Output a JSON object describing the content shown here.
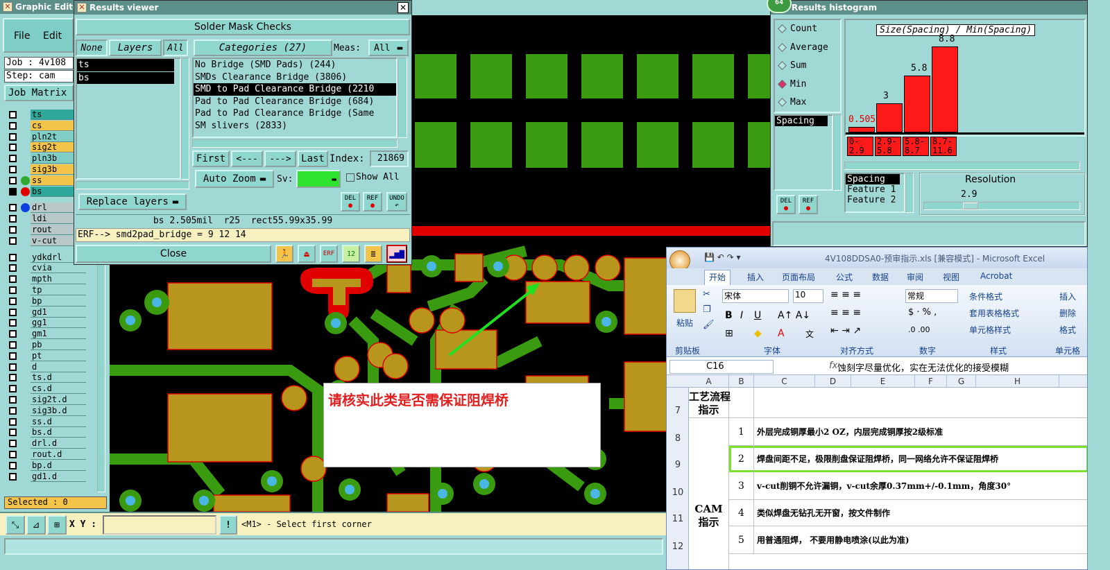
{
  "graphic_editor": {
    "title": "Graphic Editor",
    "menu": [
      "File",
      "Edit"
    ],
    "job": "Job : 4v108",
    "step": "Step: cam",
    "job_matrix": "Job Matrix",
    "layers": [
      "ts",
      "cs",
      "pln2t",
      "sig2t",
      "pln3b",
      "sig3b",
      "ss",
      "bs",
      "drl",
      "ldi",
      "rout",
      "v-cut",
      "ydkdrl",
      "cvia",
      "mpth",
      "tp",
      "bp",
      "gd1",
      "gg1",
      "gm1",
      "pb",
      "pt",
      "d",
      "ts.d",
      "cs.d",
      "sig2t.d",
      "sig3b.d",
      "ss.d",
      "bs.d",
      "drl.d",
      "rout.d",
      "bp.d",
      "gd1.d"
    ],
    "selected": "Selected : 0",
    "xy_label": "X Y :",
    "status_hint": "<M1> - Select first corner"
  },
  "results_viewer": {
    "title": "Results viewer",
    "header": "Solder Mask Checks",
    "none": "None",
    "layers": "Layers",
    "all": "All",
    "categories": "Categories (27)",
    "meas_label": "Meas:",
    "meas_value": "All",
    "layer_list": [
      "ts",
      "bs"
    ],
    "category_list": [
      "No Bridge (SMD Pads) (244)",
      "SMDs Clearance Bridge (3806)",
      "SMD to Pad Clearance Bridge (2210",
      "Pad to Pad Clearance Bridge (684)",
      "Pad to Pad Clearance Bridge (Same",
      "SM slivers (2833)"
    ],
    "first": "First",
    "prev": "<---",
    "next": "--->",
    "last": "Last",
    "index_label": "Index:",
    "index_value": "21869",
    "auto_zoom": "Auto Zoom",
    "sv_label": "Sv:",
    "show_all": "Show All",
    "replace_layers": "Replace layers",
    "info": "bs 2.505mil  r25  rect55.99x35.99",
    "erf": "ERF--> smd2pad_bridge = 9 12 14",
    "close": "Close",
    "del": "DEL",
    "ref": "REF",
    "undo": "UNDO"
  },
  "histogram": {
    "title": "Results histogram",
    "badge": "64",
    "radios": [
      "Count",
      "Average",
      "Sum",
      "Min",
      "Max"
    ],
    "selected_radio": "Min",
    "spacing": "Spacing",
    "chart_title": "Size(Spacing) / Min(Spacing)",
    "bar_labels": [
      "0.505",
      "3",
      "5.8",
      "8.8"
    ],
    "bins": [
      "0-\n2.9",
      "2.9-\n5.8",
      "5.8-\n8.7",
      "8.7-\n11.6"
    ],
    "list": [
      "Spacing",
      "Feature 1",
      "Feature 2"
    ],
    "resolution": "Resolution",
    "resolution_value": "2.9",
    "del": "DEL",
    "ref": "REF"
  },
  "canvas": {
    "annotation": "请核实此类是否需保证阻焊桥"
  },
  "excel": {
    "title": "4V108DDSA0-预审指示.xls  [兼容模式] - Microsoft Excel",
    "tabs": [
      "开始",
      "插入",
      "页面布局",
      "公式",
      "数据",
      "审阅",
      "视图",
      "Acrobat"
    ],
    "paste": "粘贴",
    "clipboard": "剪贴板",
    "font_name": "宋体",
    "font_size": "10",
    "font_group": "字体",
    "align_group": "对齐方式",
    "number_format": "常规",
    "number_group": "数字",
    "cond_format": "条件格式",
    "table_format": "套用表格格式",
    "cell_style": "单元格样式",
    "style_group": "样式",
    "insert": "插入",
    "delete": "删除",
    "format": "格式",
    "cell_group": "单元格",
    "cell_ref": "C16",
    "fx": "fx",
    "formula": "蚀刻字尽量优化，实在无法优化的接受模糊",
    "columns": [
      "A",
      "B",
      "C",
      "D",
      "E",
      "F",
      "G",
      "H"
    ],
    "row7_label": "工艺流程\n指示",
    "cam_label": "CAM\n指示",
    "rows": [
      {
        "num": "7",
        "idx": "",
        "text": ""
      },
      {
        "num": "8",
        "idx": "1",
        "text": "外层完成铜厚最小2 OZ，内层完成铜厚按2级标准"
      },
      {
        "num": "9",
        "idx": "2",
        "text": "焊盘间距不足，极限削盘保证阻焊桥，同一网络允许不保证阻焊桥"
      },
      {
        "num": "10",
        "idx": "3",
        "text": "v-cut削铜不允许漏铜，v-cut余厚0.37mm+/-0.1mm，角度30°"
      },
      {
        "num": "11",
        "idx": "4",
        "text": "类似焊盘无钻孔无开窗，按文件制作"
      },
      {
        "num": "12",
        "idx": "5",
        "text": "用普通阻焊， 不要用静电喷涂(以此为准)"
      }
    ]
  },
  "colors": {
    "teal": "#9fd8d4",
    "copper": "#b8961e",
    "trace": "#3a9a10",
    "mask_red": "#e00000",
    "highlight": "#7be02a"
  }
}
